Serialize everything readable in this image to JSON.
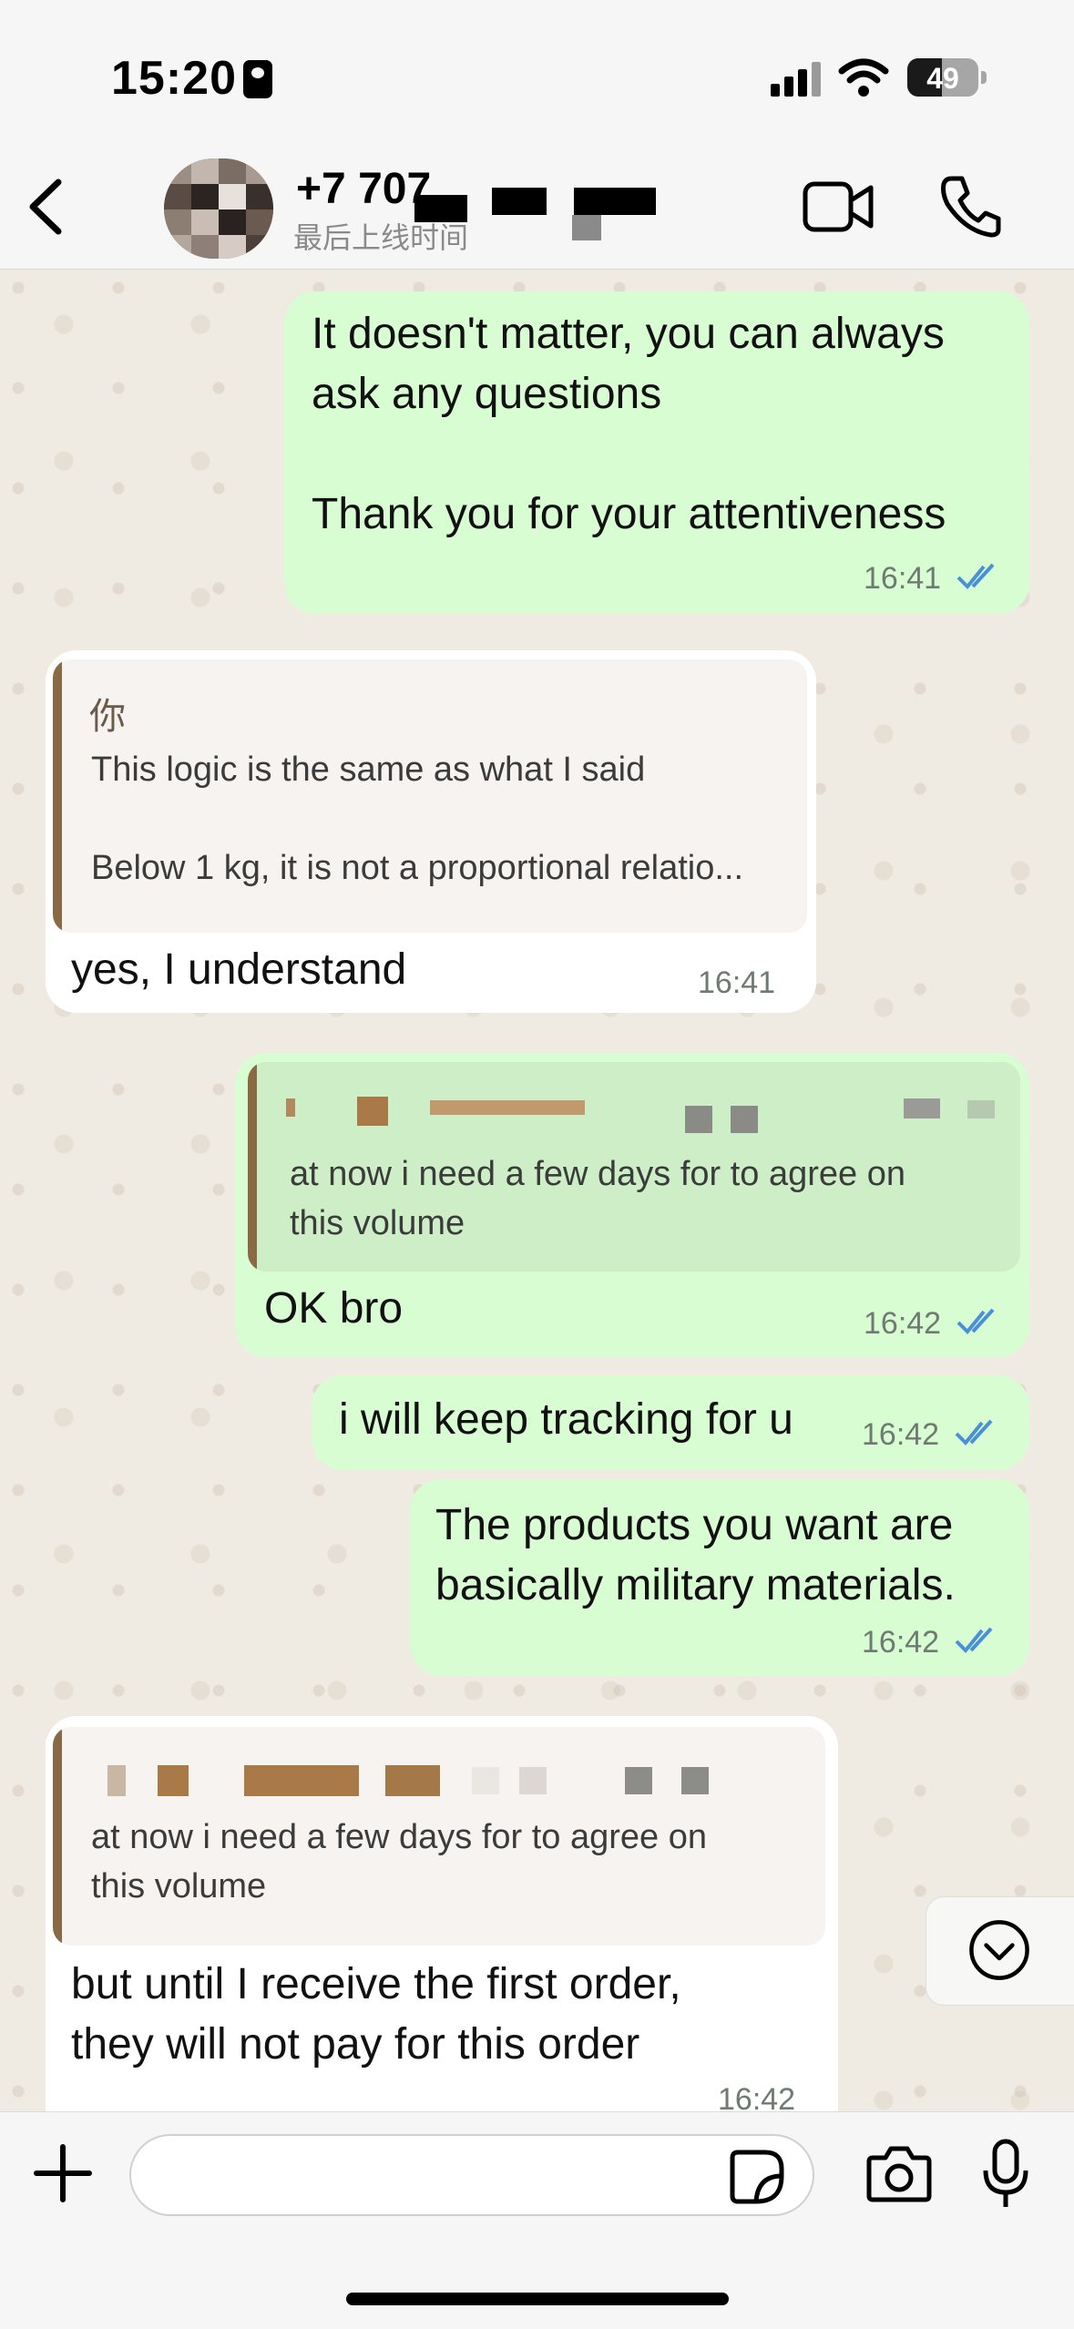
{
  "status_bar": {
    "time": "15:20",
    "battery": "49",
    "battery_level": 0.49
  },
  "header": {
    "contact_name": "+7 707",
    "contact_subtitle": "最后上线时间",
    "icons": [
      "back-chevron-icon",
      "video-call-icon",
      "phone-call-icon"
    ]
  },
  "messages": [
    {
      "side": "out",
      "lines": [
        "It doesn't matter, you can always",
        "ask any questions",
        "",
        "Thank you for your attentiveness"
      ],
      "time": "16:41",
      "status": "read"
    },
    {
      "side": "in",
      "quote": {
        "author": "你",
        "lines": [
          "This logic is the same as what I said",
          "",
          "Below 1 kg, it is not a proportional relatio..."
        ]
      },
      "lines": [
        "yes, I understand"
      ],
      "time": "16:41"
    },
    {
      "side": "out",
      "quote": {
        "lines": [
          "at now i need a few days for to agree on",
          "this volume"
        ]
      },
      "lines": [
        "OK bro"
      ],
      "time": "16:42",
      "status": "read"
    },
    {
      "side": "out",
      "lines": [
        "i will keep tracking for u"
      ],
      "time": "16:42",
      "status": "read"
    },
    {
      "side": "out",
      "lines": [
        "The products you want are",
        "basically military materials."
      ],
      "time": "16:42",
      "status": "read"
    },
    {
      "side": "in",
      "quote": {
        "lines": [
          "at now i need a few days for to agree on",
          "this volume"
        ]
      },
      "lines": [
        "but until I receive the first order,",
        "they will not pay for this order"
      ],
      "time": "16:42"
    }
  ],
  "input": {
    "placeholder": ""
  },
  "colors": {
    "outgoing_bubble": "#d9fdd3",
    "incoming_bubble": "#ffffff",
    "read_ticks": "#4a90d9",
    "chat_background": "#efeae2"
  }
}
